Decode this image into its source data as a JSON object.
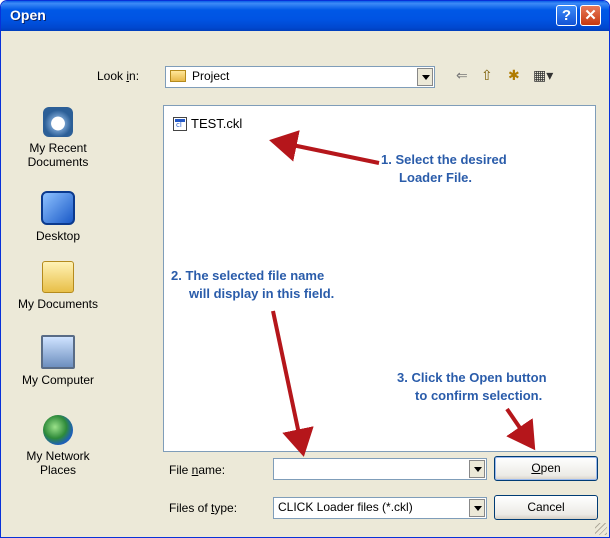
{
  "window": {
    "title": "Open",
    "help_glyph": "?",
    "close_glyph": "✕"
  },
  "look_in": {
    "label_pre": "Look ",
    "label_u": "i",
    "label_post": "n:",
    "value": "Project"
  },
  "toolbar": {
    "back_glyph": "⇐",
    "up_glyph": "⇧",
    "new_folder_glyph": "✱",
    "views_glyph": "▦▾"
  },
  "places": [
    {
      "line1": "My Recent",
      "line2": "Documents",
      "icon": "clock-icon"
    },
    {
      "line1": "Desktop",
      "line2": "",
      "icon": "desktop-icon"
    },
    {
      "line1": "My Documents",
      "line2": "",
      "icon": "folder-icon"
    },
    {
      "line1": "My Computer",
      "line2": "",
      "icon": "computer-icon"
    },
    {
      "line1": "My Network",
      "line2": "Places",
      "icon": "globe-icon"
    }
  ],
  "files": [
    {
      "name": "TEST.ckl"
    }
  ],
  "annotations": {
    "step1": "1. Select the desired\n     Loader File.",
    "step2": "2. The selected file name\n     will display in this field.",
    "step3": "3. Click the Open button\n     to confirm selection."
  },
  "file_name": {
    "label_pre": "File ",
    "label_u": "n",
    "label_post": "ame:",
    "value": ""
  },
  "file_type": {
    "label_pre": "Files of ",
    "label_u": "t",
    "label_post": "ype:",
    "value": "CLICK Loader files (*.ckl)"
  },
  "buttons": {
    "open_u": "O",
    "open_post": "pen",
    "cancel": "Cancel"
  },
  "colors": {
    "annotation": "#2a5caa",
    "arrow": "#b5161b",
    "title_bar": "#0054e3"
  }
}
